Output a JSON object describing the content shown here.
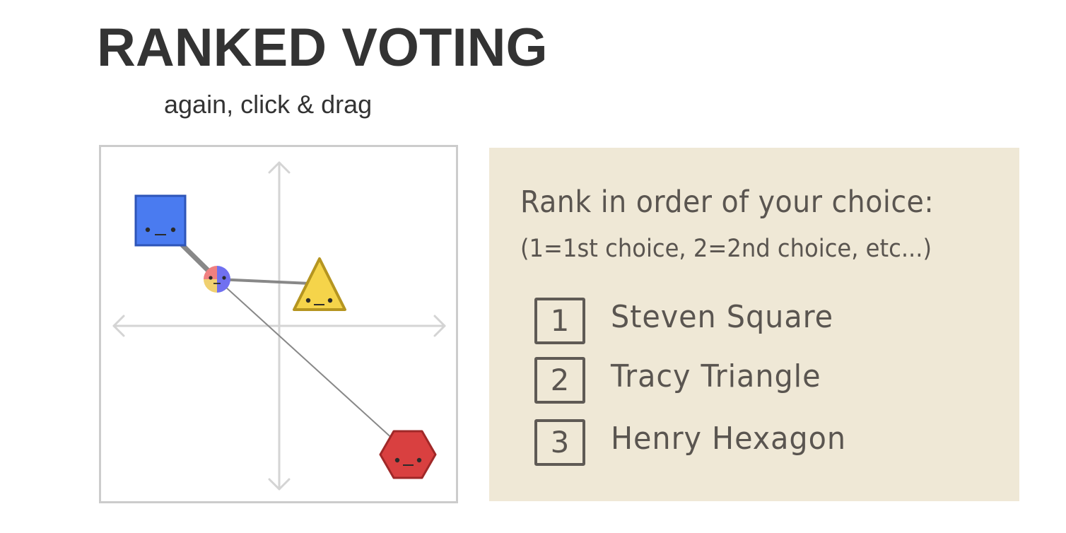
{
  "header": {
    "title": "RANKED VOTING",
    "subtitle": "again, click & drag"
  },
  "simulation": {
    "axes": "crosshair arrows",
    "voter": {
      "name": "voter-pie",
      "slice_colors": [
        "#f08080",
        "#f0d070",
        "#7070f0"
      ]
    },
    "candidates": [
      {
        "id": "square",
        "shape": "square",
        "color": "#4a7bf0",
        "border": "#2e55b8",
        "icon": "square-candidate-icon"
      },
      {
        "id": "triangle",
        "shape": "triangle",
        "color": "#f5d44a",
        "border": "#b59520",
        "icon": "triangle-candidate-icon"
      },
      {
        "id": "hexagon",
        "shape": "hexagon",
        "color": "#d94040",
        "border": "#a02828",
        "icon": "hexagon-candidate-icon"
      }
    ],
    "colors": {
      "axis": "#d4d4d4",
      "line": "#888888",
      "face": "#333333"
    }
  },
  "ballot": {
    "heading": "Rank in order of your choice:",
    "hint": "(1=1st choice, 2=2nd choice, etc...)",
    "rows": [
      {
        "rank": "1",
        "name": "Steven Square"
      },
      {
        "rank": "2",
        "name": "Tracy Triangle"
      },
      {
        "rank": "3",
        "name": "Henry Hexagon"
      }
    ],
    "background": "#efe8d6",
    "ink": "#5a5550"
  }
}
